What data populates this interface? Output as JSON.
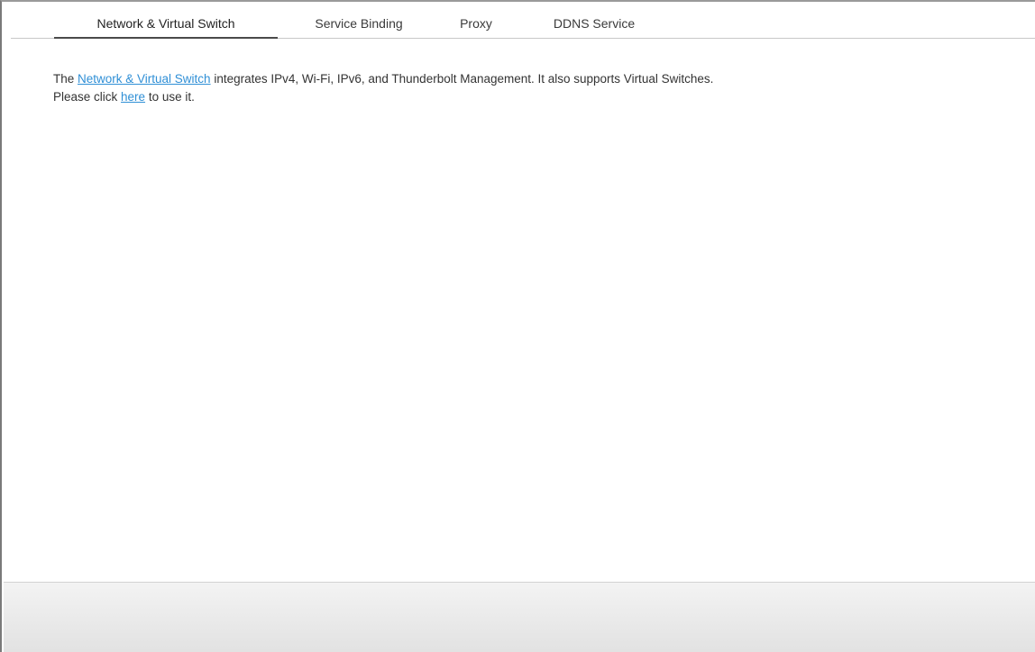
{
  "tabs": [
    {
      "label": "Network & Virtual Switch",
      "active": true
    },
    {
      "label": "Service Binding",
      "active": false
    },
    {
      "label": "Proxy",
      "active": false
    },
    {
      "label": "DDNS Service",
      "active": false
    }
  ],
  "content": {
    "line1_prefix": "The ",
    "line1_link": "Network & Virtual Switch",
    "line1_suffix": " integrates IPv4, Wi-Fi, IPv6, and Thunderbolt Management. It also supports Virtual Switches.",
    "line2_prefix": "Please click ",
    "line2_link": "here",
    "line2_suffix": " to use it."
  },
  "colors": {
    "link": "#2f8fd6",
    "active_tab_underline": "#4a4a4a",
    "footer_bg": "#e9e9e9"
  }
}
